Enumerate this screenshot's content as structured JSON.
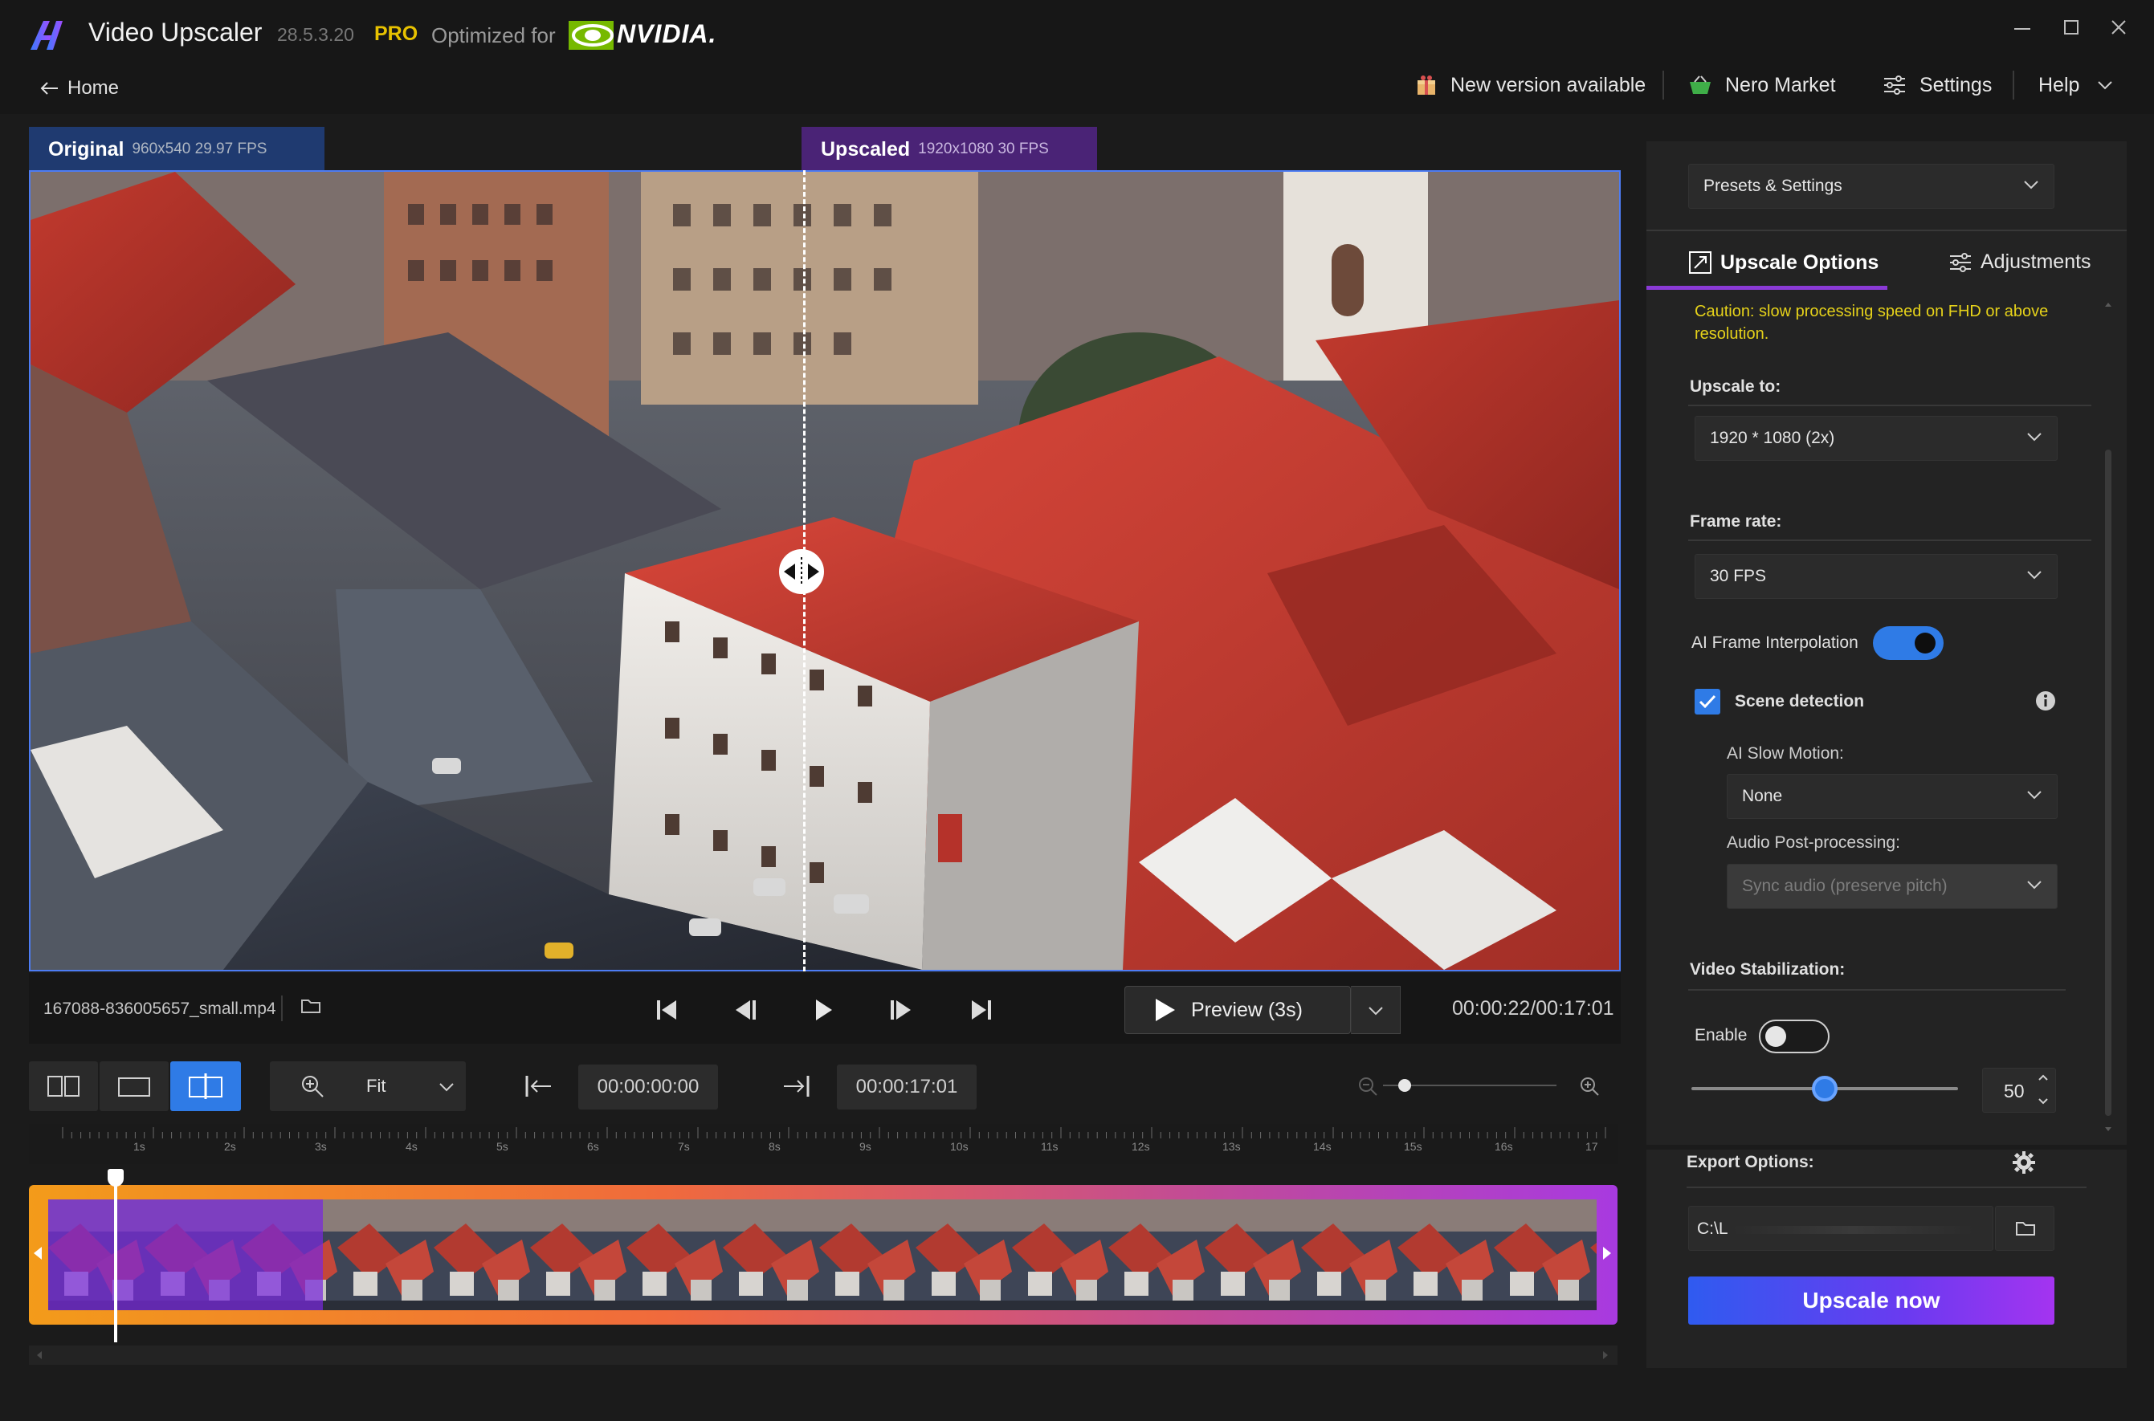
{
  "app": {
    "title": "Video Upscaler",
    "version": "28.5.3.20",
    "edition": "PRO",
    "optimized_label": "Optimized for",
    "partner": "NVIDIA.",
    "home_label": "Home"
  },
  "nav": {
    "new_version": "New version available",
    "market": "Nero Market",
    "settings": "Settings",
    "help": "Help"
  },
  "video": {
    "original_tab": {
      "title": "Original",
      "meta": "960x540 29.97 FPS"
    },
    "upscaled_tab": {
      "title": "Upscaled",
      "meta": "1920x1080 30 FPS"
    },
    "filename": "167088-836005657_small.mp4",
    "preview_label": "Preview (3s)",
    "timecode": "00:00:22/00:17:01"
  },
  "toolbar": {
    "zoom_mode": "Fit",
    "start_time": "00:00:00:00",
    "end_time": "00:00:17:01",
    "timeline_zoom_level": 0.05
  },
  "ruler": {
    "labels": [
      "1s",
      "2s",
      "3s",
      "4s",
      "5s",
      "6s",
      "7s",
      "8s",
      "9s",
      "10s",
      "11s",
      "12s",
      "13s",
      "14s",
      "15s",
      "16s",
      "17"
    ]
  },
  "timeline": {
    "playhead_fraction": 0.05,
    "processed_fraction": 0.18
  },
  "panel": {
    "presets_label": "Presets & Settings",
    "tab_upscale": "Upscale Options",
    "tab_adjustments": "Adjustments",
    "caution": "Caution: slow processing speed on FHD or above resolution.",
    "upscale_to_label": "Upscale to:",
    "upscale_to_value": "1920 * 1080 (2x)",
    "frame_rate_label": "Frame rate:",
    "frame_rate_value": "30 FPS",
    "ai_interp_label": "AI Frame Interpolation",
    "ai_interp_on": true,
    "scene_detection_label": "Scene detection",
    "scene_detection_checked": true,
    "slow_motion_label": "AI Slow Motion:",
    "slow_motion_value": "None",
    "audio_label": "Audio Post-processing:",
    "audio_value": "Sync audio (preserve pitch)",
    "stabilization_label": "Video Stabilization:",
    "enable_label": "Enable",
    "stabilization_on": false,
    "stabilization_value": "50",
    "stabilization_level": 0.5,
    "export_label": "Export Options:",
    "export_path": "C:\\L",
    "upscale_now": "Upscale now"
  },
  "colors": {
    "accent_blue": "#2f7be6",
    "accent_purple": "#8a3ad6",
    "pro_yellow": "#e8c200",
    "caution_yellow": "#e6d21a",
    "nvidia_green": "#76b900"
  },
  "icons": {
    "minimize": "minimize-icon",
    "maximize": "maximize-icon",
    "close": "close-icon",
    "back": "arrow-left-icon",
    "update": "gift-icon",
    "market": "basket-icon",
    "settings": "sliders-icon",
    "help_dropdown": "chevron-down-icon"
  }
}
